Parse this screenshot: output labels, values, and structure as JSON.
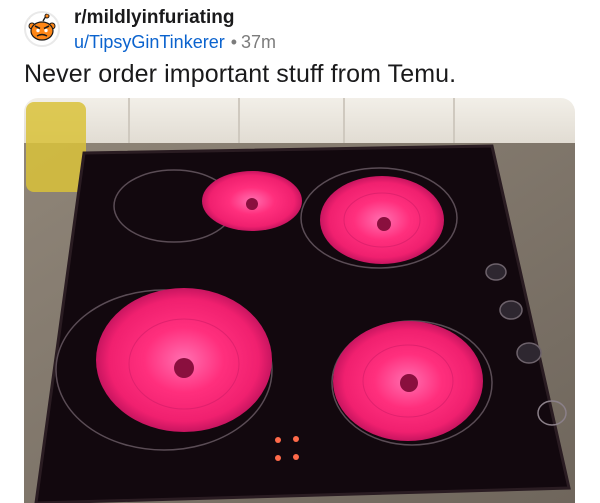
{
  "post": {
    "subreddit": "r/mildlyinfuriating",
    "author": "u/TipsyGinTinkerer",
    "separator": "•",
    "age": "37m",
    "title": "Never order important stuff from Temu."
  },
  "icons": {
    "subreddit_avatar": "snoo-angry-icon"
  },
  "colors": {
    "link": "#0b63ce",
    "meta_gray": "#7c7c7c",
    "text": "#1a1a1b",
    "burner_glow": "#ff2f7d"
  }
}
